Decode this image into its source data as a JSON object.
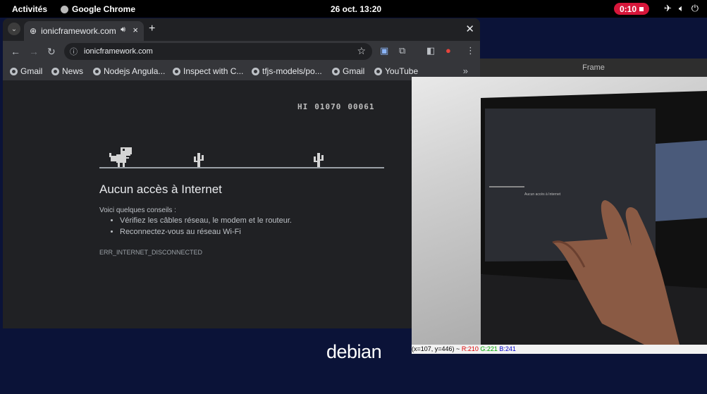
{
  "topbar": {
    "activities": "Activités",
    "app_name": "Google Chrome",
    "clock": "26 oct.  13:20",
    "recording": "0:10"
  },
  "chrome": {
    "tab_title": "ionicframework.com",
    "url": "ionicframework.com",
    "bookmarks": [
      "Gmail",
      "News",
      "Nodejs Angula...",
      "Inspect with C...",
      "tfjs-models/po...",
      "Gmail",
      "YouTube"
    ],
    "page": {
      "hi_label": "HI",
      "hi_score": "01070",
      "score": "00061",
      "title": "Aucun accès à Internet",
      "tips_heading": "Voici quelques conseils :",
      "tips": [
        "Vérifiez les câbles réseau, le modem et le routeur.",
        "Reconnectez-vous au réseau Wi-Fi"
      ],
      "error_code": "ERR_INTERNET_DISCONNECTED"
    }
  },
  "frame": {
    "title": "Frame",
    "status": {
      "coords": "(x=107, y=446) ~",
      "r": "R:210",
      "g": "G:221",
      "b": "B:241"
    },
    "screen_text": "Aucun accès à Internet"
  },
  "desktop": {
    "logo": "debian"
  }
}
